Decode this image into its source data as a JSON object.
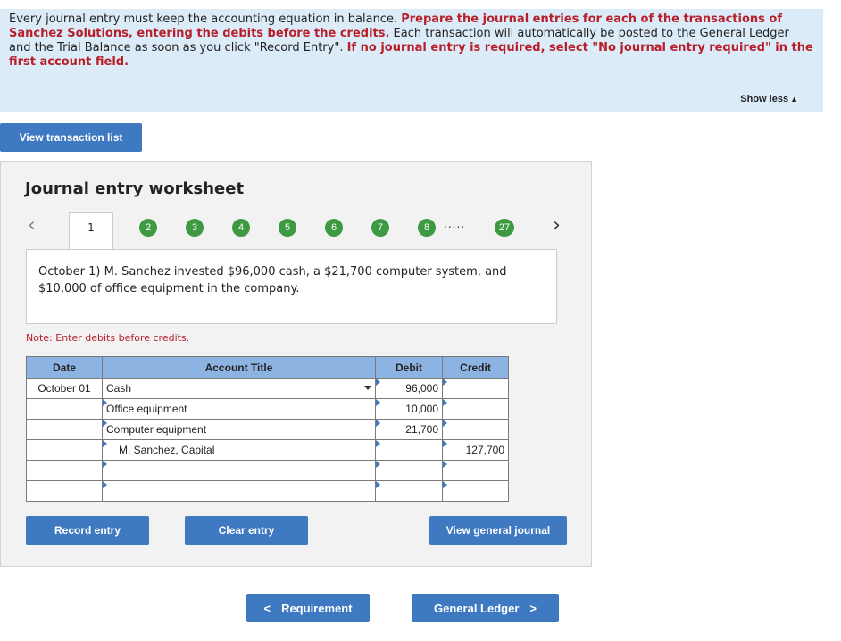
{
  "instructions": {
    "part1": "Every journal entry must keep the accounting equation in balance. ",
    "part2": "Prepare the journal entries for each of the transactions of Sanchez Solutions, entering the debits before the credits.",
    "part3": " Each transaction will automatically be posted to the General Ledger and the Trial Balance as soon as you click \"Record Entry\". ",
    "part4": "If no journal entry is required, select \"No journal entry required\" in the first account field."
  },
  "show_less": {
    "label": "Show less",
    "icon": "triangle-up-icon"
  },
  "view_transaction_list": "View transaction list",
  "worksheet": {
    "title": "Journal entry worksheet",
    "tabs": {
      "active": "1",
      "others": [
        "2",
        "3",
        "4",
        "5",
        "6",
        "7",
        "8"
      ],
      "ellipsis": ".....",
      "last": "27"
    },
    "transaction": "October 1) M. Sanchez invested $96,000 cash, a $21,700 computer system, and $10,000 of office equipment in the company.",
    "note": "Note: Enter debits before credits.",
    "table": {
      "headers": {
        "date": "Date",
        "account": "Account Title",
        "debit": "Debit",
        "credit": "Credit"
      },
      "rows": [
        {
          "date": "October 01",
          "account": "Cash",
          "debit": "96,000",
          "credit": ""
        },
        {
          "date": "",
          "account": "Office equipment",
          "debit": "10,000",
          "credit": ""
        },
        {
          "date": "",
          "account": "Computer equipment",
          "debit": "21,700",
          "credit": ""
        },
        {
          "date": "",
          "account": "M. Sanchez, Capital",
          "debit": "",
          "credit": "127,700"
        },
        {
          "date": "",
          "account": "",
          "debit": "",
          "credit": ""
        },
        {
          "date": "",
          "account": "",
          "debit": "",
          "credit": ""
        }
      ]
    },
    "buttons": {
      "record": "Record entry",
      "clear": "Clear entry",
      "view_general_journal": "View general journal"
    }
  },
  "nav": {
    "requirement": "Requirement",
    "general_ledger": "General Ledger"
  },
  "colors": {
    "accent_blue": "#3e79c1",
    "tab_green": "#3d9a43",
    "header_blue": "#8db3e2",
    "instruction_red": "#b7202a",
    "instruction_bg": "#dcebf8"
  }
}
